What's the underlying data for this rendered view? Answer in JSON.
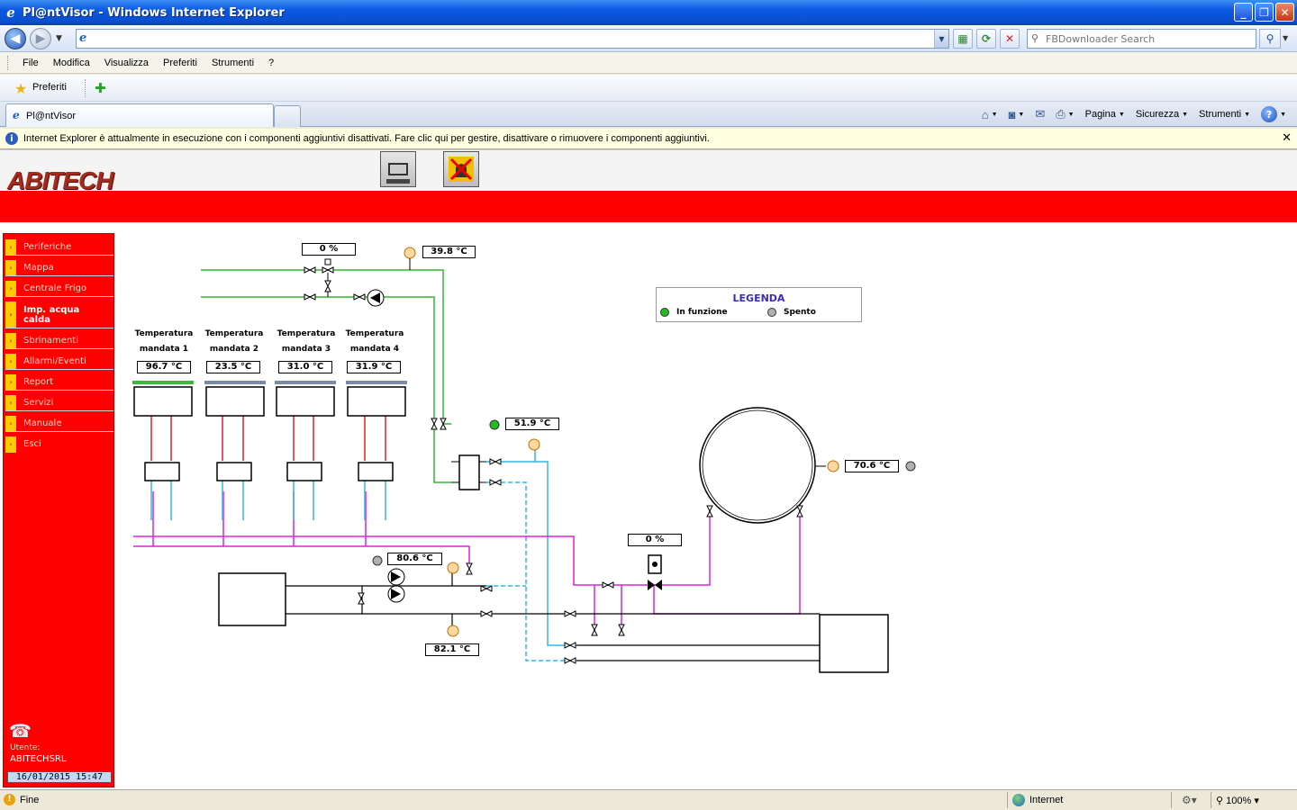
{
  "browser": {
    "window_title": "Pl@ntVisor - Windows Internet Explorer",
    "address_value": "",
    "search_placeholder": "FBDownloader Search",
    "menu": [
      "File",
      "Modifica",
      "Visualizza",
      "Preferiti",
      "Strumenti",
      "?"
    ],
    "favorites_label": "Preferiti",
    "tab_label": "Pl@ntVisor",
    "commands": {
      "page": "Pagina",
      "security": "Sicurezza",
      "tools": "Strumenti"
    },
    "infobar_text": "Internet Explorer è attualmente in esecuzione con i componenti aggiuntivi disattivati. Fare clic qui per gestire, disattivare o rimuovere i componenti aggiuntivi.",
    "status_text": "Fine",
    "zone_label": "Internet",
    "zoom_label": "100%"
  },
  "app": {
    "logo_text": "ABITECH",
    "sidebar": {
      "items": [
        {
          "label": "Periferiche",
          "active": false
        },
        {
          "label": "Mappa",
          "active": false
        },
        {
          "label": "Centrale Frigo",
          "active": false
        },
        {
          "label": "Imp. acqua calda",
          "active": true
        },
        {
          "label": "Sbrinamenti",
          "active": false
        },
        {
          "label": "Allarmi/Eventi",
          "active": false
        },
        {
          "label": "Report",
          "active": false
        },
        {
          "label": "Servizi",
          "active": false
        },
        {
          "label": "Manuale",
          "active": false
        },
        {
          "label": "Esci",
          "active": false
        }
      ],
      "user_label": "Utente:",
      "user_name": "ABITECHSRL",
      "datetime": "16/01/2015 15:47"
    }
  },
  "plant": {
    "valve_top_opening": "0 %",
    "temp_top": "39.8 °C",
    "mandate": [
      {
        "title1": "Temperatura",
        "title2": "mandata 1",
        "value": "96.7 °C",
        "status": "on"
      },
      {
        "title1": "Temperatura",
        "title2": "mandata 2",
        "value": "23.5 °C",
        "status": "off"
      },
      {
        "title1": "Temperatura",
        "title2": "mandata 3",
        "value": "31.0 °C",
        "status": "off"
      },
      {
        "title1": "Temperatura",
        "title2": "mandata 4",
        "value": "31.9 °C",
        "status": "off"
      }
    ],
    "exchanger_temp": "51.9 °C",
    "tank_temp": "70.6 °C",
    "valve_mix_opening": "0 %",
    "pump_temp": "80.6 °C",
    "return_temp": "82.1 °C",
    "legend": {
      "title": "LEGENDA",
      "on_label": "In funzione",
      "off_label": "Spento",
      "on_color": "#22bb22",
      "off_color": "#b0b0b0"
    },
    "colors": {
      "green_pipe": "#2dbb2d",
      "magenta_pipe": "#e020e0",
      "cyan_pipe": "#30b8e0",
      "red_pipe": "#e02020"
    }
  }
}
